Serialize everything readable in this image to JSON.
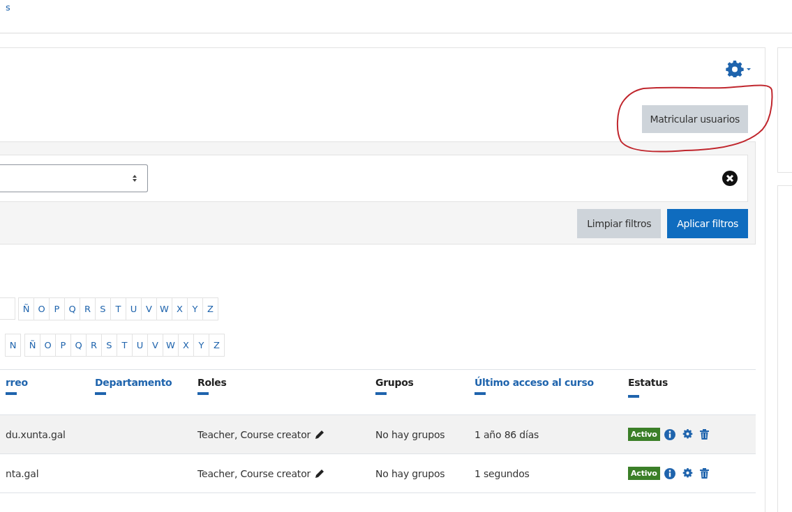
{
  "breadcrumb": "s",
  "enrol_button": "Matricular usuarios",
  "filter": {
    "clear_button": "Limpiar filtros",
    "apply_button": "Aplicar filtros"
  },
  "letter_bars": [
    [
      "Ñ",
      "O",
      "P",
      "Q",
      "R",
      "S",
      "T",
      "U",
      "V",
      "W",
      "X",
      "Y",
      "Z"
    ],
    [
      "N",
      "Ñ",
      "O",
      "P",
      "Q",
      "R",
      "S",
      "T",
      "U",
      "V",
      "W",
      "X",
      "Y",
      "Z"
    ]
  ],
  "table": {
    "columns": [
      {
        "label": "rreo",
        "sortable": true
      },
      {
        "label": "Departamento",
        "sortable": true
      },
      {
        "label": "Roles",
        "sortable": false
      },
      {
        "label": "Grupos",
        "sortable": false
      },
      {
        "label": "Último acceso al curso",
        "sortable": true
      },
      {
        "label": "Estatus",
        "sortable": false
      }
    ],
    "rows": [
      {
        "email": "du.xunta.gal",
        "department": "",
        "roles": "Teacher, Course creator",
        "groups": "No hay grupos",
        "last_access": "1 año 86 días",
        "status": "Activo",
        "highlighted": true
      },
      {
        "email": "nta.gal",
        "department": "",
        "roles": "Teacher, Course creator",
        "groups": "No hay grupos",
        "last_access": "1 segundos",
        "status": "Activo",
        "highlighted": false
      }
    ]
  }
}
